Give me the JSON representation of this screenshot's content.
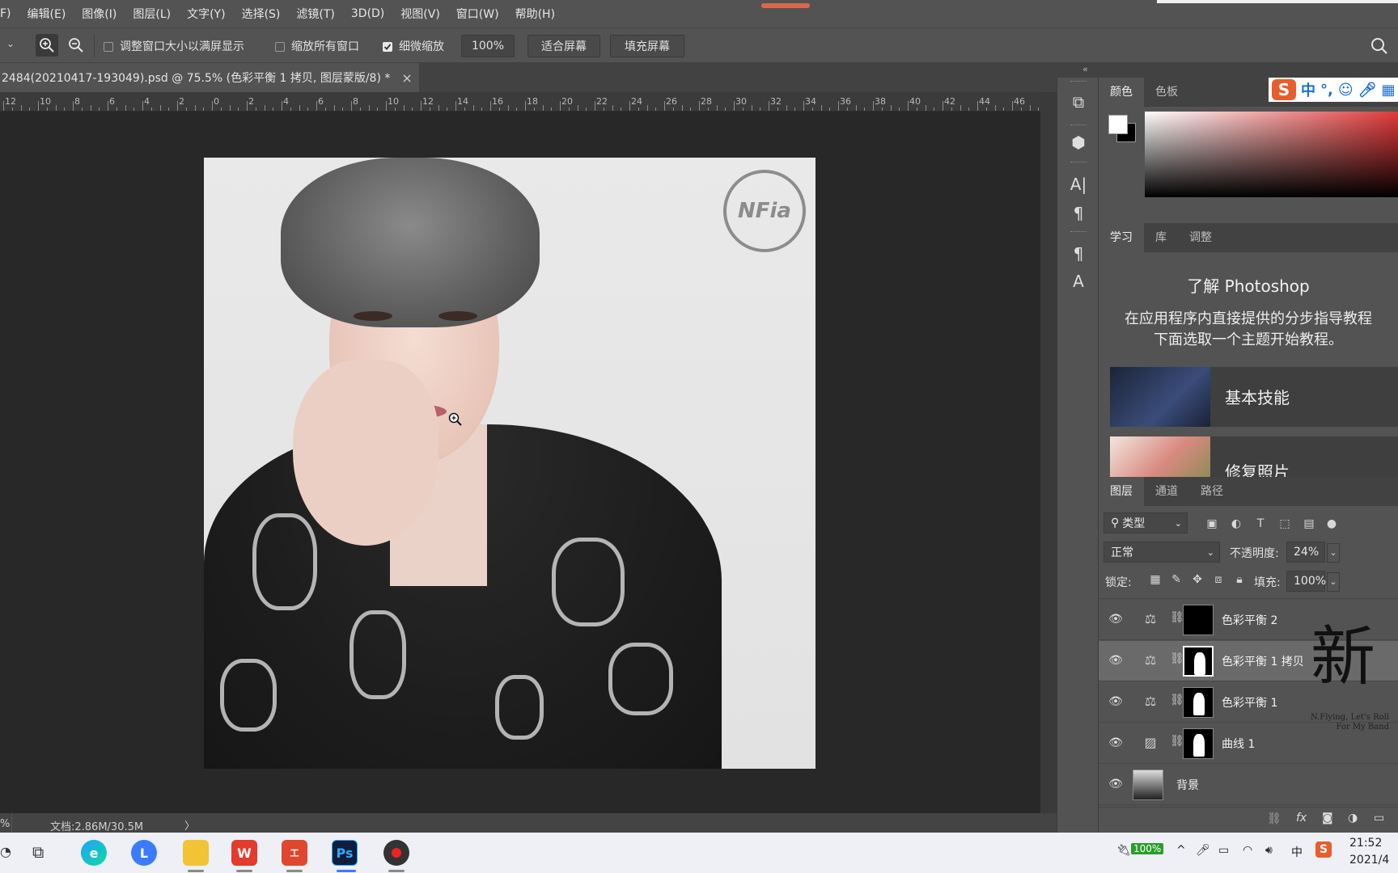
{
  "menu": [
    "F)",
    "编辑(E)",
    "图像(I)",
    "图层(L)",
    "文字(Y)",
    "选择(S)",
    "滤镜(T)",
    "3D(D)",
    "视图(V)",
    "窗口(W)",
    "帮助(H)"
  ],
  "options": {
    "resize_windows_label": "调整窗口大小以满屏显示",
    "zoom_all_label": "缩放所有窗口",
    "scrubby_zoom_label": "细微缩放",
    "zoom_value": "100%",
    "fit_screen": "适合屏幕",
    "fill_screen": "填充屏幕"
  },
  "document": {
    "tab_title": "2484(20210417-193049).psd  @  75.5%  (色彩平衡 1 拷贝, 图层蒙版/8) *",
    "close": "×",
    "status": "文档:2.86M/30.5M",
    "status_zoom": "%",
    "status_arrow": "〉"
  },
  "ruler_ticks": [
    "12",
    "10",
    "8",
    "6",
    "4",
    "2",
    "0",
    "2",
    "4",
    "6",
    "8",
    "10",
    "12",
    "14",
    "16",
    "18",
    "20",
    "22",
    "24",
    "26",
    "28",
    "30",
    "32",
    "34",
    "36",
    "38",
    "40",
    "42",
    "44",
    "46"
  ],
  "watermark_logo": "NFia",
  "color_panel": {
    "tabs": [
      "颜色",
      "色板"
    ]
  },
  "ime": {
    "s": "S",
    "zh": "中",
    "punct": "°,"
  },
  "learn_panel": {
    "tabs": [
      "学习",
      "库",
      "调整"
    ],
    "title": "了解 Photoshop",
    "line1": "在应用程序内直接提供的分步指导教程",
    "line2": "下面选取一个主题开始教程。",
    "cards": [
      "基本技能",
      "修复照片"
    ]
  },
  "layers_panel": {
    "tabs": [
      "图层",
      "通道",
      "路径"
    ],
    "filter_kind": "类型",
    "blend_mode": "正常",
    "opacity_label": "不透明度:",
    "opacity_value": "24%",
    "lock_label": "锁定:",
    "fill_label": "填充:",
    "fill_value": "100%",
    "layers": [
      {
        "name": "色彩平衡 2",
        "selected": false
      },
      {
        "name": "色彩平衡 1 拷贝",
        "selected": true
      },
      {
        "name": "色彩平衡 1",
        "selected": false
      },
      {
        "name": "曲线 1",
        "selected": false
      },
      {
        "name": "背景",
        "selected": false
      }
    ],
    "fx_label": "fx"
  },
  "overlay": {
    "calligraphy": "新",
    "line1": "N.Flying, Let's Roll",
    "line2": "For My Band"
  },
  "taskbar": {
    "battery": "100%",
    "ime": "中",
    "time": "21:52",
    "date": "2021/4"
  },
  "colors": {
    "accent": "#e85d2c",
    "panel": "#535353",
    "canvas": "#282828"
  }
}
